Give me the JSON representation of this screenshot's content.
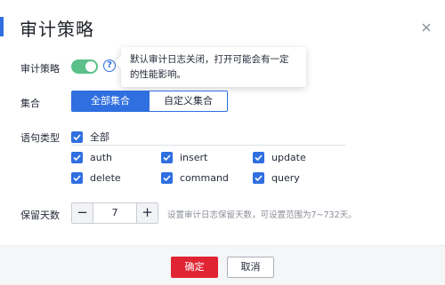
{
  "dialog": {
    "title": "审计策略"
  },
  "audit": {
    "label": "审计策略",
    "enabled": true,
    "help_glyph": "?",
    "tooltip": "默认审计日志关闭，打开可能会有一定的性能影响。"
  },
  "collection": {
    "label": "集合",
    "options": [
      "全部集合",
      "自定义集合"
    ],
    "selected": "全部集合"
  },
  "statement_types": {
    "label": "语句类型",
    "all_label": "全部",
    "items": [
      "auth",
      "insert",
      "update",
      "delete",
      "command",
      "query"
    ],
    "checked": [
      true,
      true,
      true,
      true,
      true,
      true
    ]
  },
  "retention": {
    "label": "保留天数",
    "minus": "−",
    "value": "7",
    "plus": "+",
    "hint": "设置审计日志保留天数，可设置范围为7~732天。"
  },
  "footer": {
    "confirm_label": "确定",
    "cancel_label": "取消"
  },
  "colors": {
    "accent": "#2f6fe0",
    "toggle_on": "#5cc08b",
    "confirm": "#e02433"
  }
}
